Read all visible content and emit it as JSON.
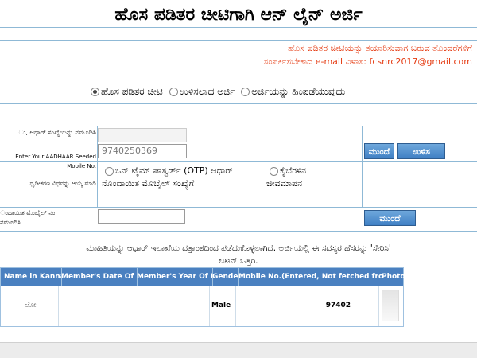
{
  "title": "ಹೊಸ ಪಡಿತರ ಚೀಟಿಗಾಗಿ ಆನ್ ಲೈನ್ ಅರ್ಜಿ",
  "notice": {
    "line1": "ಹೊಸ ಪಡಿತರ ಚೀಟಿಯನ್ನು ತಯಾರಿಸುವಾಗ ಬರುವ ತೊಂದರೆಗಳಿಗೆ",
    "line2": "ಸಂಪರ್ಕಿಸಬೇಕಾದ e-mail ವಿಳಾಸ: fcsnrc2017@gmail.com"
  },
  "radios": [
    {
      "label": "ಹೊಸ ಪಡಿತರ ಚೀಟಿ",
      "selected": true
    },
    {
      "label": "ಉಳಿಸಲಾದ ಅರ್ಜಿ",
      "selected": false
    },
    {
      "label": "ಅರ್ಜಿಯನ್ನು ಹಿಂಪಡೆಯುವುದು",
      "selected": false
    }
  ],
  "aadhaar": {
    "label1": "ು, ಆಧಾರ್ ಸಂಖ್ಯೆಯನ್ನು ನಮೂದಿಸಿ",
    "label2": "Enter Your AADHAAR Seeded Mobile No.",
    "value1": "",
    "value2": "9740250369",
    "next_label": "ಮುಂದೆ",
    "save_label": "ಉಳಿಸ"
  },
  "auth": {
    "label": "ಧೃಡೀಕರಣ ವಿಧವನ್ನು ಆಯ್ಕೆ ಮಾಡಿ",
    "option1_line1": "ಒನ್ ಟೈಮ್ ಪಾಸ್ವರ್ಡ್ (OTP) ಆಧಾರ್",
    "option1_line2": "ನೊಂದಾಯಿತ ಮೊಬೈಲ್ ಸಂಖ್ಯೆಗೆ",
    "option2_line1": "ಕೈಬೆರಳಿನ",
    "option2_line2": "ಜೀವಮಾಪನ"
  },
  "mobile": {
    "label1": "ಂದಾಯಿತ ಮೊಬೈಲ್ ನಂ",
    "label2": "ನಮೂದಿಸಿ",
    "value": "",
    "next_label": "ಮುಂದೆ"
  },
  "info": {
    "line1": "ಮಾಹಿತಿಯನ್ನು ಆಧಾರ್ ಇಲಾಖೆಯ ದತ್ತಾಂಶದಿಂದ ಪಡೆದುಕೊಳ್ಳಲಾಗಿದೆ. ಅರ್ಜಿಯಲ್ಲಿ ಈ ಸದಸ್ಯರ ಹೆಸರನ್ನು 'ಸೇರಿಸಿ'",
    "line2": "ಬಟನ್ ಒತ್ತಿರಿ."
  },
  "table": {
    "headers": [
      "Name in Kannada",
      "Member's Date Of Birth",
      "Member's Year Of Birth",
      "Gender",
      "Mobile No.(Entered, Not fetched from Aadhaar)",
      "Photo"
    ],
    "row": {
      "name": "ಲೋ",
      "dob": "",
      "yob": "",
      "gender": "Male",
      "mobile": "97402",
      "photo": ""
    }
  }
}
